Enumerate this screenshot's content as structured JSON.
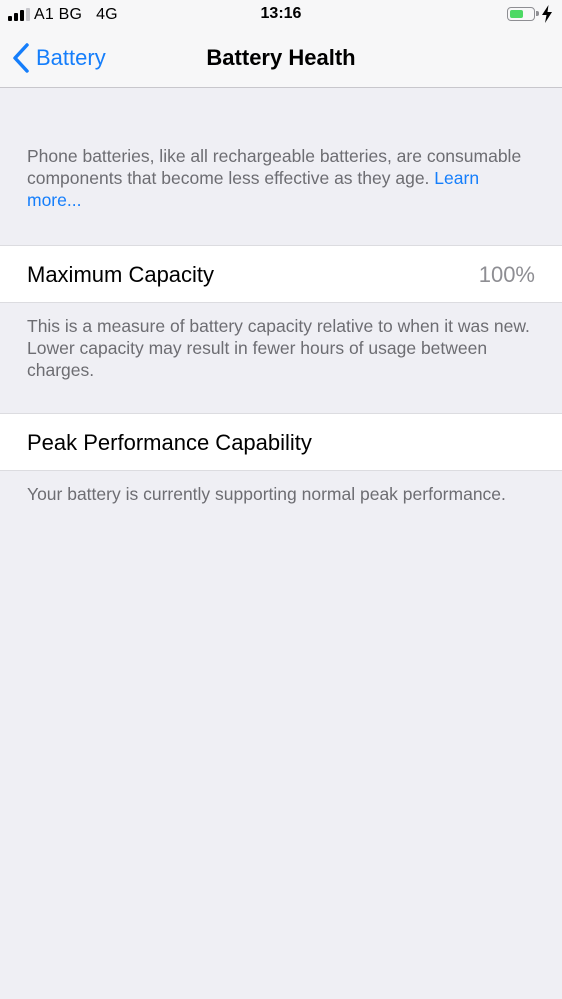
{
  "status_bar": {
    "carrier": "A1 BG",
    "network": "4G",
    "time": "13:16",
    "signal_bars": 4,
    "signal_bars_active": 3,
    "battery_level": 0.6,
    "charging": true,
    "battery_color": "#4cd964"
  },
  "nav": {
    "back_label": "Battery",
    "title": "Battery Health",
    "accent_color": "#157efb"
  },
  "intro": {
    "text": "Phone batteries, like all rechargeable batteries, are consumable components that become less effective as they age.",
    "link_label": "Learn more..."
  },
  "max_capacity": {
    "label": "Maximum Capacity",
    "value": "100%",
    "footer": "This is a measure of battery capacity relative to when it was new. Lower capacity may result in fewer hours of usage between charges."
  },
  "peak_performance": {
    "label": "Peak Performance Capability",
    "footer": "Your battery is currently supporting normal peak performance."
  }
}
